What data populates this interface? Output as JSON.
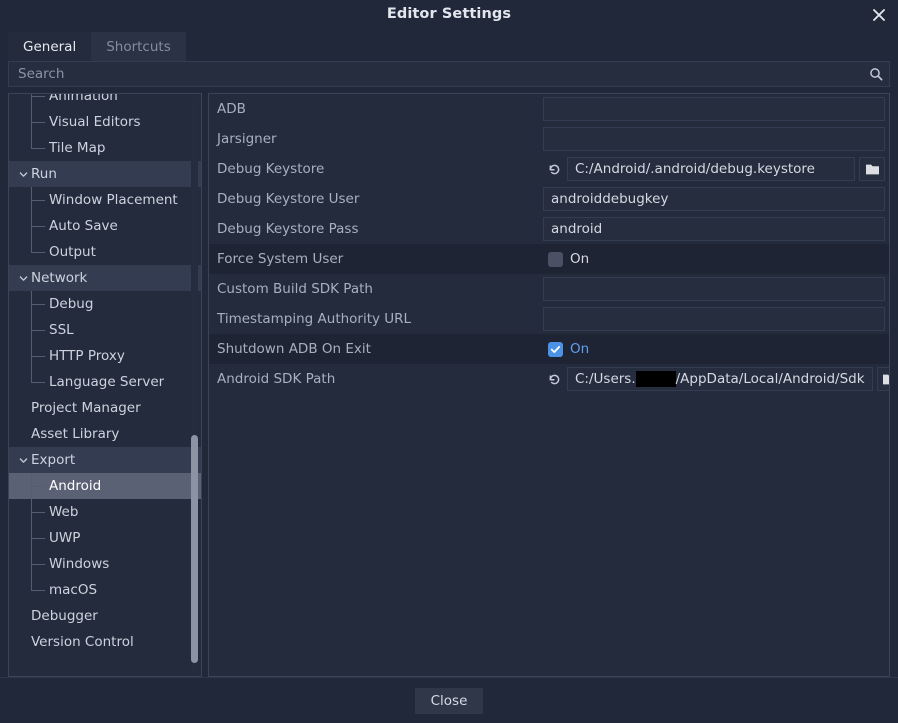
{
  "window": {
    "title": "Editor Settings",
    "close_icon": "close-icon"
  },
  "tabs": [
    {
      "label": "General",
      "active": true
    },
    {
      "label": "Shortcuts",
      "active": false
    }
  ],
  "search": {
    "placeholder": "Search",
    "value": "",
    "icon": "search-icon"
  },
  "sidebar": {
    "items": [
      {
        "label": "Animation",
        "depth": 1,
        "expandable": false,
        "state": "none",
        "last": false
      },
      {
        "label": "Visual Editors",
        "depth": 1,
        "expandable": false,
        "state": "none",
        "last": false
      },
      {
        "label": "Tile Map",
        "depth": 1,
        "expandable": false,
        "state": "none",
        "last": true
      },
      {
        "label": "Run",
        "depth": 0,
        "expandable": true,
        "state": "parentsel",
        "last": false
      },
      {
        "label": "Window Placement",
        "depth": 1,
        "expandable": false,
        "state": "none",
        "last": false
      },
      {
        "label": "Auto Save",
        "depth": 1,
        "expandable": false,
        "state": "none",
        "last": false
      },
      {
        "label": "Output",
        "depth": 1,
        "expandable": false,
        "state": "none",
        "last": true
      },
      {
        "label": "Network",
        "depth": 0,
        "expandable": true,
        "state": "parentsel",
        "last": false
      },
      {
        "label": "Debug",
        "depth": 1,
        "expandable": false,
        "state": "none",
        "last": false
      },
      {
        "label": "SSL",
        "depth": 1,
        "expandable": false,
        "state": "none",
        "last": false
      },
      {
        "label": "HTTP Proxy",
        "depth": 1,
        "expandable": false,
        "state": "none",
        "last": false
      },
      {
        "label": "Language Server",
        "depth": 1,
        "expandable": false,
        "state": "none",
        "last": true
      },
      {
        "label": "Project Manager",
        "depth": 0,
        "expandable": false,
        "state": "none",
        "last": false
      },
      {
        "label": "Asset Library",
        "depth": 0,
        "expandable": false,
        "state": "none",
        "last": false
      },
      {
        "label": "Export",
        "depth": 0,
        "expandable": true,
        "state": "parentsel",
        "last": false
      },
      {
        "label": "Android",
        "depth": 1,
        "expandable": false,
        "state": "sel",
        "last": false
      },
      {
        "label": "Web",
        "depth": 1,
        "expandable": false,
        "state": "none",
        "last": false
      },
      {
        "label": "UWP",
        "depth": 1,
        "expandable": false,
        "state": "none",
        "last": false
      },
      {
        "label": "Windows",
        "depth": 1,
        "expandable": false,
        "state": "none",
        "last": false
      },
      {
        "label": "macOS",
        "depth": 1,
        "expandable": false,
        "state": "none",
        "last": true
      },
      {
        "label": "Debugger",
        "depth": 0,
        "expandable": false,
        "state": "none",
        "last": false
      },
      {
        "label": "Version Control",
        "depth": 0,
        "expandable": false,
        "state": "none",
        "last": false
      }
    ]
  },
  "properties": [
    {
      "name": "ADB",
      "type": "text",
      "value": "",
      "revert": false,
      "folder": false,
      "alt": false
    },
    {
      "name": "Jarsigner",
      "type": "text",
      "value": "",
      "revert": false,
      "folder": false,
      "alt": false
    },
    {
      "name": "Debug Keystore",
      "type": "text",
      "value": "C:/Android/.android/debug.keystore",
      "revert": true,
      "folder": true,
      "alt": false
    },
    {
      "name": "Debug Keystore User",
      "type": "text",
      "value": "androiddebugkey",
      "revert": false,
      "folder": false,
      "alt": false
    },
    {
      "name": "Debug Keystore Pass",
      "type": "text",
      "value": "android",
      "revert": false,
      "folder": false,
      "alt": false
    },
    {
      "name": "Force System User",
      "type": "checkbox",
      "value": "On",
      "checked": false,
      "revert": false,
      "folder": false,
      "alt": true
    },
    {
      "name": "Custom Build SDK Path",
      "type": "text",
      "value": "",
      "revert": false,
      "folder": false,
      "alt": false
    },
    {
      "name": "Timestamping Authority URL",
      "type": "text",
      "value": "",
      "revert": false,
      "folder": false,
      "alt": false
    },
    {
      "name": "Shutdown ADB On Exit",
      "type": "checkbox",
      "value": "On",
      "checked": true,
      "revert": false,
      "folder": false,
      "alt": true
    },
    {
      "name": "Android SDK Path",
      "type": "redacted",
      "value_prefix": "C:/Users.",
      "value_suffix": "/AppData/Local/Android/Sdk",
      "revert": true,
      "folder": true,
      "alt": false
    }
  ],
  "footer": {
    "close_label": "Close"
  },
  "colors": {
    "accent": "#4c93e8",
    "accent_text": "#5f9ff0",
    "panel": "#242b3c",
    "selection": "#5a6175"
  }
}
